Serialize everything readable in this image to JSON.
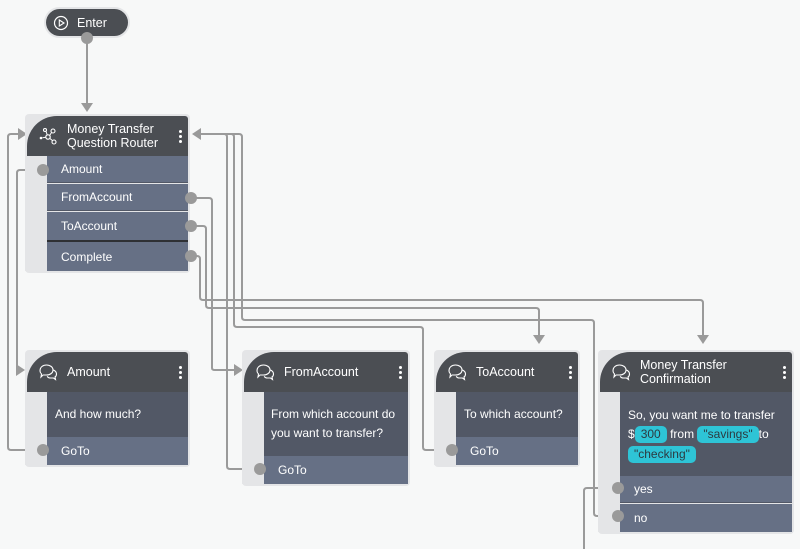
{
  "colors": {
    "canvas": "#f7f8f8",
    "node_header": "#4b4e53",
    "node_body": "#525866",
    "node_row": "#667085",
    "wire": "#9a9a9a",
    "chip": "#2ec4d6"
  },
  "enter": {
    "label": "Enter",
    "icon": "play-circle-icon"
  },
  "router": {
    "title_line1": "Money Transfer",
    "title_line2": "Question Router",
    "icon": "router-nodes-icon",
    "rows": [
      "Amount",
      "FromAccount",
      "ToAccount",
      "Complete"
    ]
  },
  "amount": {
    "title": "Amount",
    "icon": "chat-bubbles-icon",
    "prompt": "And how much?",
    "rows": [
      "GoTo"
    ]
  },
  "from_account": {
    "title": "FromAccount",
    "icon": "chat-bubbles-icon",
    "prompt_line1": "From which account do",
    "prompt_line2": "you want to transfer?",
    "rows": [
      "GoTo"
    ]
  },
  "to_account": {
    "title": "ToAccount",
    "icon": "chat-bubbles-icon",
    "prompt": "To which account?",
    "rows": [
      "GoTo"
    ]
  },
  "confirmation": {
    "title_line1": "Money Transfer",
    "title_line2": "Confirmation",
    "icon": "chat-bubbles-icon",
    "prompt_line1": "So, you want me to transfer",
    "dollar": "$",
    "amount_chip": "300",
    "from_word": "from",
    "from_chip": "\"savings\"",
    "to_word": "to",
    "to_chip": "\"checking\"",
    "rows": [
      "yes",
      "no"
    ]
  }
}
